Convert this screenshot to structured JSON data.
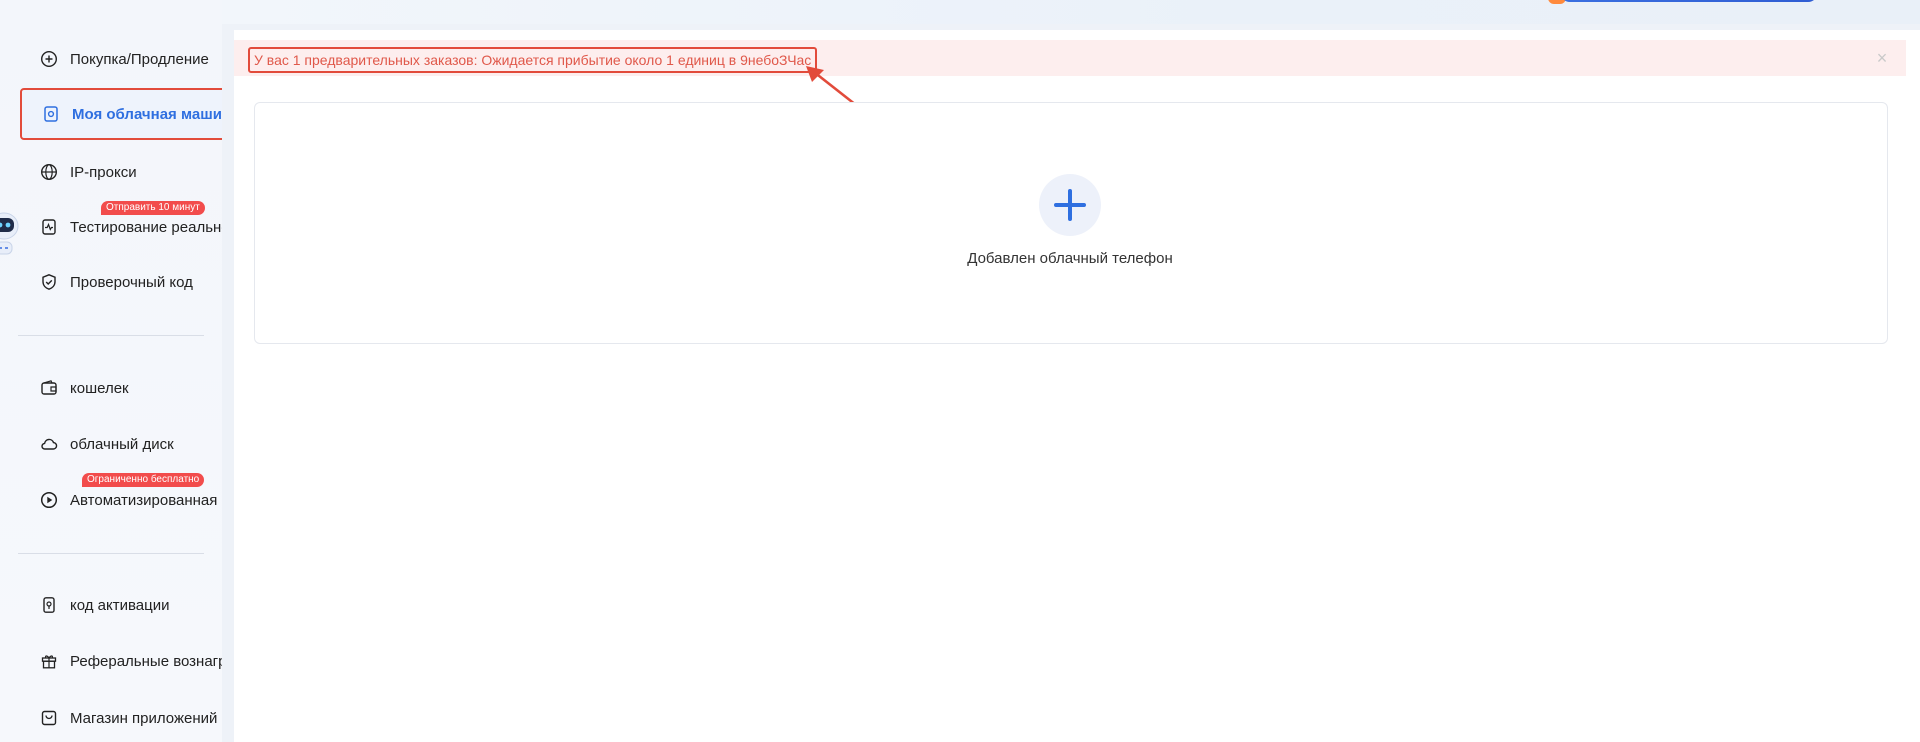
{
  "sidebar": {
    "items": [
      {
        "label": "Покупка/Продление",
        "icon": "plus-circle-icon"
      },
      {
        "label": "Моя облачная машина",
        "icon": "cloud-machine-icon",
        "active": true
      },
      {
        "label": "IP-прокси",
        "icon": "globe-icon"
      },
      {
        "label": "Тестирование реального",
        "icon": "pulse-icon",
        "badge": "Отправить 10 минут"
      },
      {
        "label": "Проверочный код",
        "icon": "shield-icon"
      },
      {
        "label": "кошелек",
        "icon": "wallet-icon"
      },
      {
        "label": "облачный диск",
        "icon": "cloud-icon"
      },
      {
        "label": "Автоматизированная ог",
        "icon": "play-circle-icon",
        "badge": "Ограниченно бесплатно"
      },
      {
        "label": "код активации",
        "icon": "activation-code-icon"
      },
      {
        "label": "Реферальные вознаграж",
        "icon": "gift-icon"
      },
      {
        "label": "Магазин приложений",
        "icon": "store-icon"
      }
    ]
  },
  "notice": {
    "text": "У вас 1 предварительных заказов: Ожидается прибытие около 1 единиц в 9небоЗЧас",
    "close_glyph": "×"
  },
  "main": {
    "add_label": "Добавлен облачный телефон"
  },
  "colors": {
    "accent": "#2f6fe0",
    "highlight": "#e24b3b",
    "badge": "#f24c4c",
    "notice_bg": "#fdeeee"
  }
}
